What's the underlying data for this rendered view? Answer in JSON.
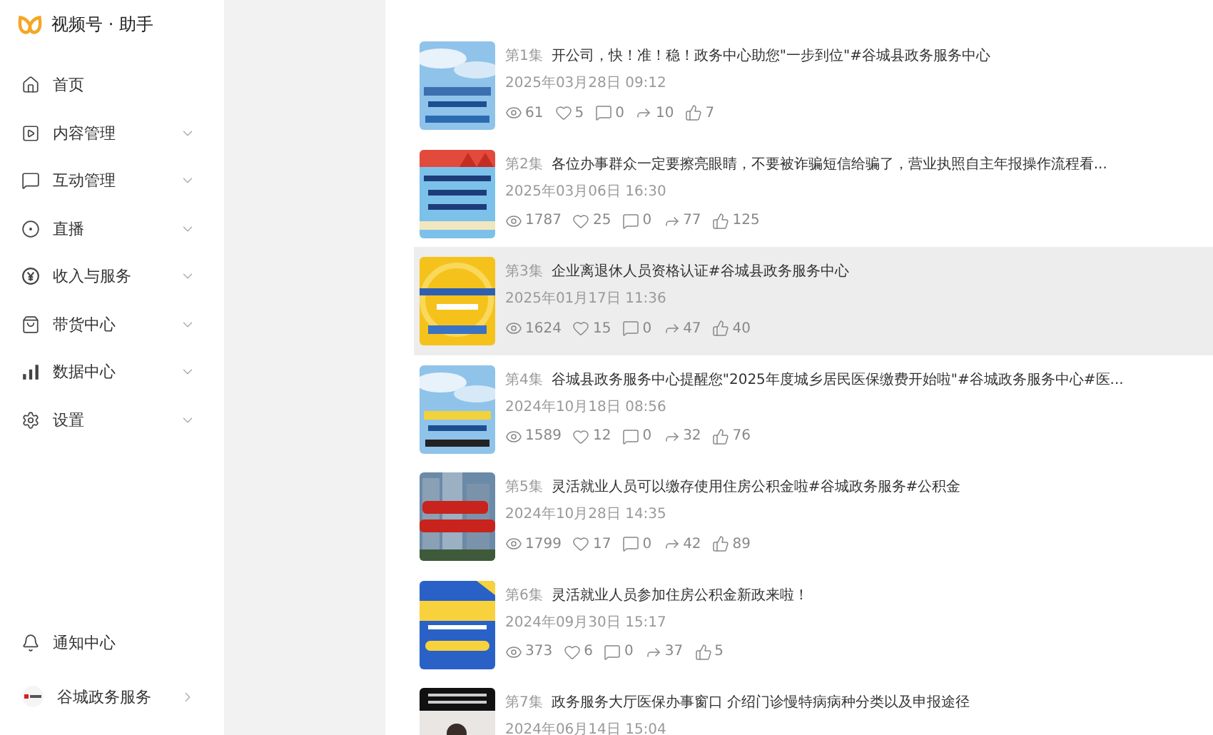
{
  "app": {
    "title": "视频号 · 助手"
  },
  "sidebar": {
    "items": [
      {
        "label": "首页",
        "has_submenu": false
      },
      {
        "label": "内容管理",
        "has_submenu": true
      },
      {
        "label": "互动管理",
        "has_submenu": true
      },
      {
        "label": "直播",
        "has_submenu": true
      },
      {
        "label": "收入与服务",
        "has_submenu": true
      },
      {
        "label": "带货中心",
        "has_submenu": true
      },
      {
        "label": "数据中心",
        "has_submenu": true
      },
      {
        "label": "设置",
        "has_submenu": true
      }
    ],
    "notifications": "通知中心",
    "account": {
      "name": "谷城政务服务"
    }
  },
  "videos": [
    {
      "episode": "第1集",
      "title": "开公司，快！准！稳！政务中心助您\"一步到位\"#谷城县政务服务中心",
      "date": "2025年03月28日 09:12",
      "views": "61",
      "favorites": "5",
      "comments": "0",
      "shares": "10",
      "likes": "7",
      "hovered": false
    },
    {
      "episode": "第2集",
      "title": "各位办事群众一定要擦亮眼睛，不要被诈骗短信给骗了，营业执照自主年报操作流程看...",
      "date": "2025年03月06日 16:30",
      "views": "1787",
      "favorites": "25",
      "comments": "0",
      "shares": "77",
      "likes": "125",
      "hovered": false
    },
    {
      "episode": "第3集",
      "title": "企业离退休人员资格认证#谷城县政务服务中心",
      "date": "2025年01月17日 11:36",
      "views": "1624",
      "favorites": "15",
      "comments": "0",
      "shares": "47",
      "likes": "40",
      "hovered": true
    },
    {
      "episode": "第4集",
      "title": "谷城县政务服务中心提醒您\"2025年度城乡居民医保缴费开始啦\"#谷城政务服务中心#医...",
      "date": "2024年10月18日 08:56",
      "views": "1589",
      "favorites": "12",
      "comments": "0",
      "shares": "32",
      "likes": "76",
      "hovered": false
    },
    {
      "episode": "第5集",
      "title": "灵活就业人员可以缴存使用住房公积金啦#谷城政务服务#公积金",
      "date": "2024年10月28日 14:35",
      "views": "1799",
      "favorites": "17",
      "comments": "0",
      "shares": "42",
      "likes": "89",
      "hovered": false
    },
    {
      "episode": "第6集",
      "title": "灵活就业人员参加住房公积金新政来啦！",
      "date": "2024年09月30日 15:17",
      "views": "373",
      "favorites": "6",
      "comments": "0",
      "shares": "37",
      "likes": "5",
      "hovered": false
    },
    {
      "episode": "第7集",
      "title": "政务服务大厅医保办事窗口 介绍门诊慢特病病种分类以及申报途径",
      "date": "2024年06月14日 15:04",
      "hovered": false
    }
  ]
}
